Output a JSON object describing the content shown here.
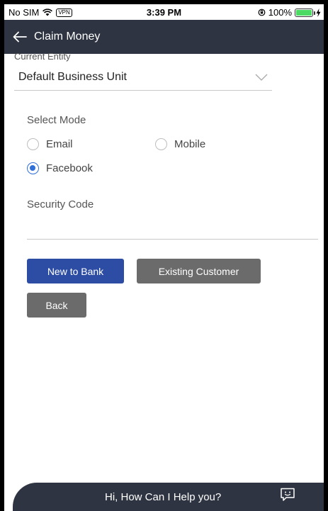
{
  "status_bar": {
    "carrier": "No SIM",
    "vpn": "VPN",
    "time": "3:39 PM",
    "battery": "100%",
    "battery_level": 1.0
  },
  "header": {
    "title": "Claim Money",
    "back_icon": "arrow-left-icon"
  },
  "entity": {
    "label": "Current Entity",
    "value": "Default Business Unit"
  },
  "mode": {
    "label": "Select Mode",
    "options": [
      {
        "label": "Email",
        "selected": false
      },
      {
        "label": "Mobile",
        "selected": false
      },
      {
        "label": "Facebook",
        "selected": true
      }
    ]
  },
  "security": {
    "label": "Security Code",
    "value": ""
  },
  "buttons": {
    "new_to_bank": "New to Bank",
    "existing_customer": "Existing Customer",
    "back": "Back"
  },
  "help": {
    "text": "Hi, How Can I Help you?",
    "icon": "chat-icon"
  },
  "colors": {
    "header_bg": "#2e3441",
    "primary": "#2c4da3",
    "secondary": "#6b6b6b",
    "radio_selected": "#2f6fd9"
  }
}
